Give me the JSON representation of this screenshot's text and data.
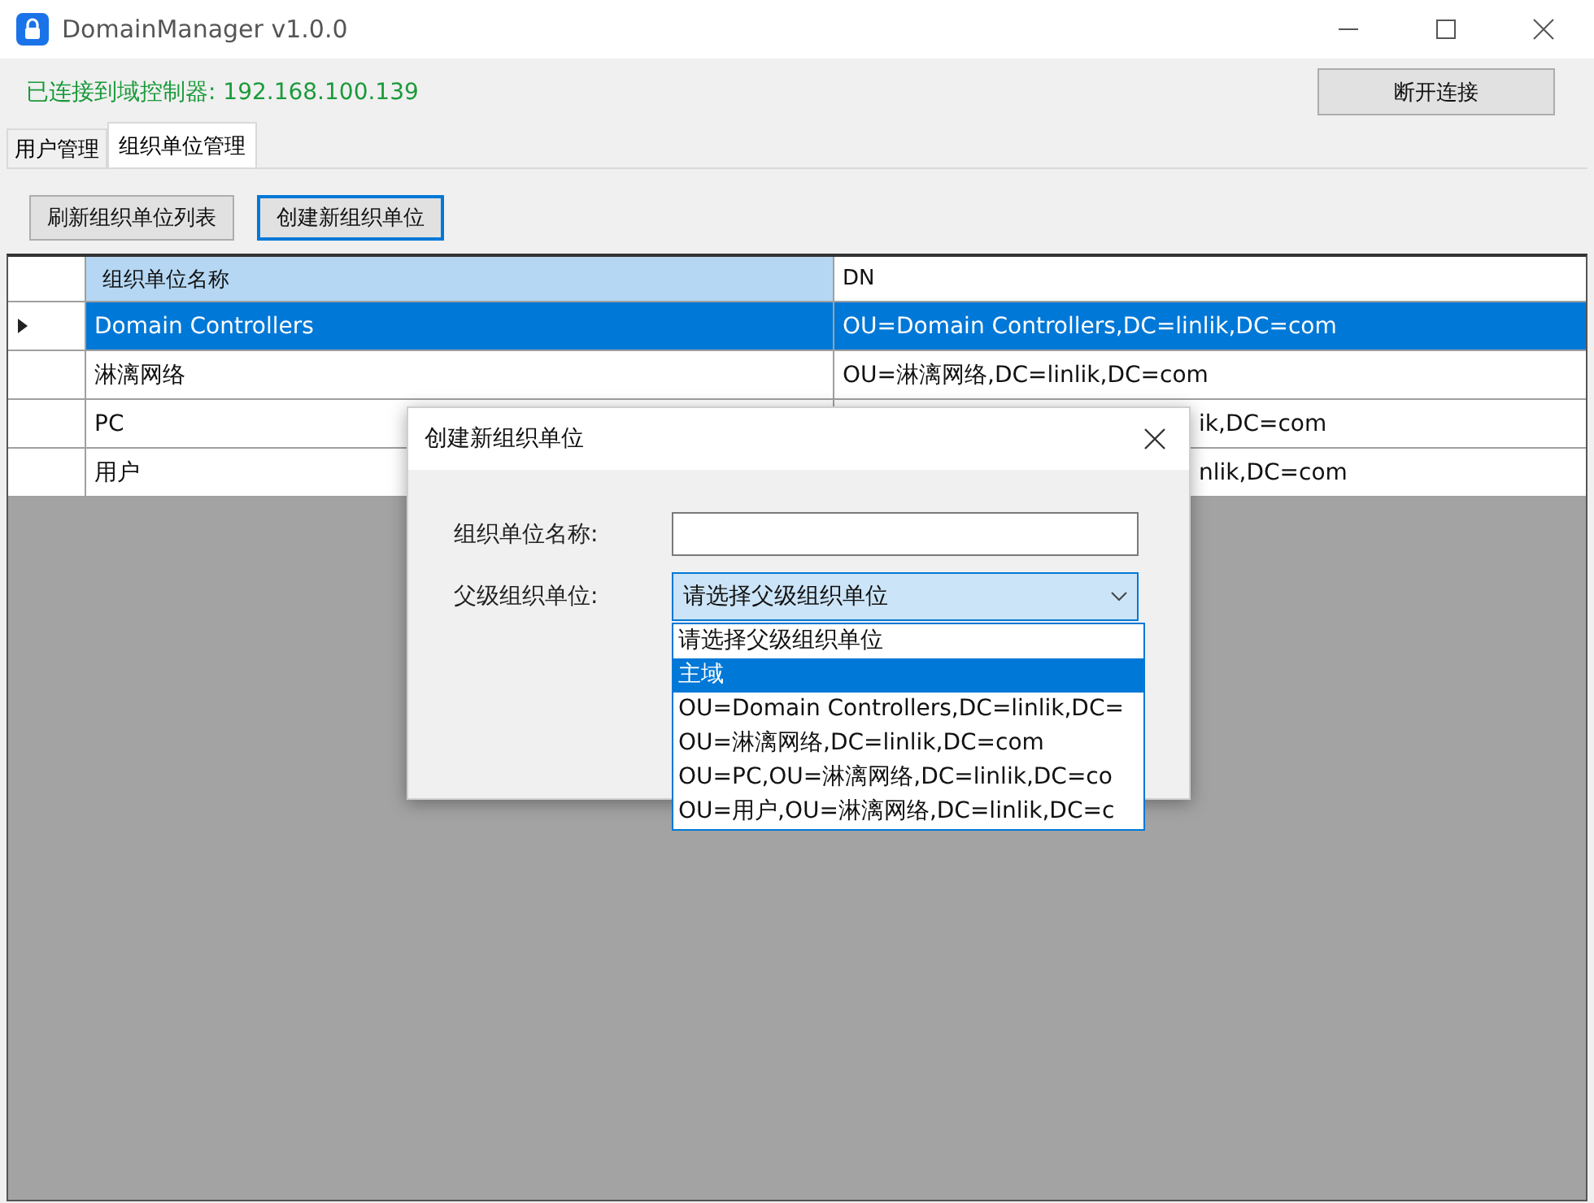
{
  "window": {
    "title": "DomainManager v1.0.0"
  },
  "status": "已连接到域控制器: 192.168.100.139",
  "disconnect_button": "断开连接",
  "tabs": [
    {
      "label": "用户管理",
      "selected": false
    },
    {
      "label": "组织单位管理",
      "selected": true
    }
  ],
  "toolbar": [
    {
      "label": "刷新组织单位列表",
      "focused": false
    },
    {
      "label": "创建新组织单位",
      "focused": true
    }
  ],
  "table": {
    "columns": [
      "组织单位名称",
      "DN"
    ],
    "rows": [
      {
        "name": "Domain Controllers",
        "dn": "OU=Domain Controllers,DC=linlik,DC=com",
        "selected": true,
        "covered": false
      },
      {
        "name": "淋漓网络",
        "dn": "OU=淋漓网络,DC=linlik,DC=com",
        "selected": false,
        "covered": false
      },
      {
        "name": "PC",
        "dn": "ik,DC=com",
        "selected": false,
        "covered": true
      },
      {
        "name": "用户",
        "dn": "nlik,DC=com",
        "selected": false,
        "covered": true
      }
    ]
  },
  "dialog": {
    "title": "创建新组织单位",
    "name_label": "组织单位名称:",
    "parent_label": "父级组织单位:",
    "parent_value": "请选择父级组织单位",
    "options": [
      {
        "label": "请选择父级组织单位",
        "selected": false
      },
      {
        "label": "主域",
        "selected": true
      },
      {
        "label": "OU=Domain Controllers,DC=linlik,DC=",
        "selected": false
      },
      {
        "label": "OU=淋漓网络,DC=linlik,DC=com",
        "selected": false
      },
      {
        "label": "OU=PC,OU=淋漓网络,DC=linlik,DC=co",
        "selected": false
      },
      {
        "label": "OU=用户,OU=淋漓网络,DC=linlik,DC=c",
        "selected": false
      }
    ]
  }
}
